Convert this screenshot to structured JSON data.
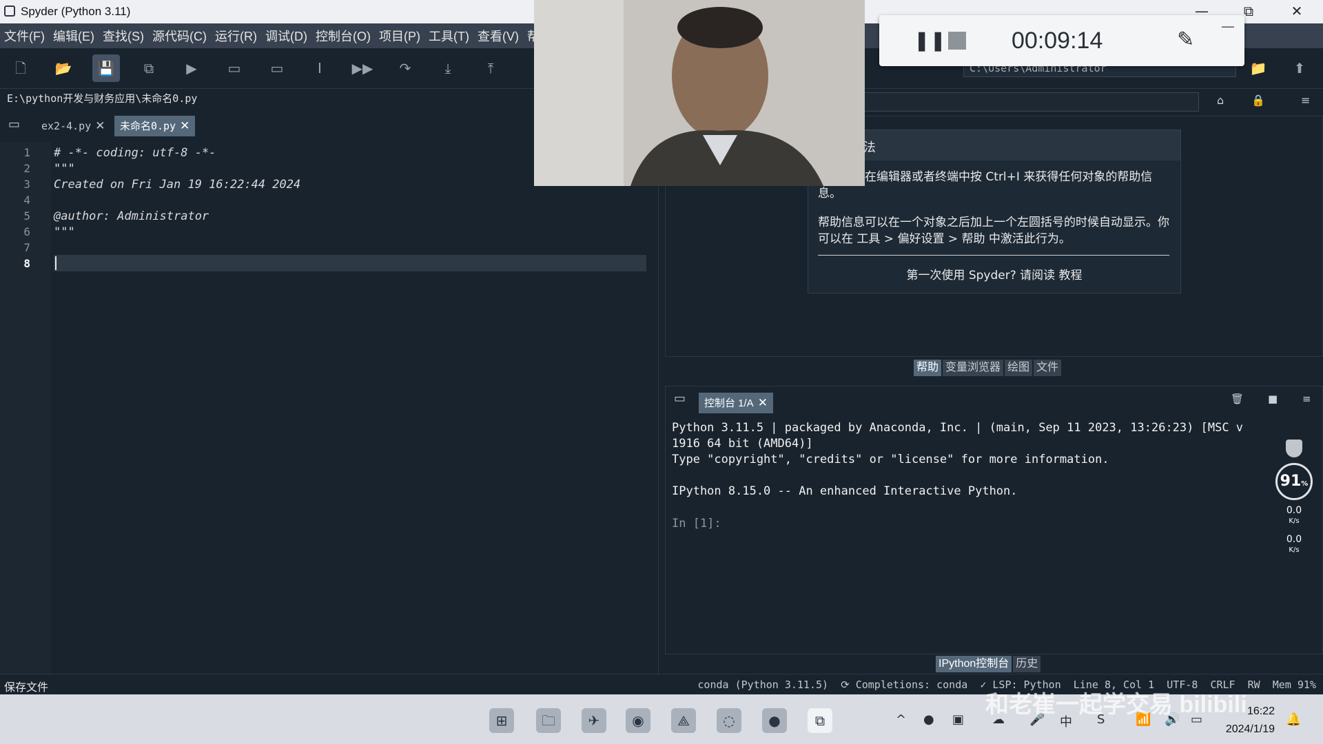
{
  "window": {
    "title": "Spyder (Python 3.11)",
    "minimize": "—",
    "maximize": "⧉",
    "close": "✕"
  },
  "menu": [
    "文件(F)",
    "编辑(E)",
    "查找(S)",
    "源代码(C)",
    "运行(R)",
    "调试(D)",
    "控制台(O)",
    "项目(P)",
    "工具(T)",
    "查看(V)",
    "帮助(H"
  ],
  "toolbar": {
    "icons": [
      "new-file-icon",
      "open-file-icon",
      "save-icon",
      "save-all-icon",
      "run-icon",
      "run-cell-icon",
      "run-cell-advance-icon",
      "run-selection-icon",
      "debug-icon",
      "step-icon",
      "step-into-icon",
      "step-return-icon"
    ],
    "cwd": "C:\\Users\\Administrator"
  },
  "editor": {
    "path": "E:\\python开发与财务应用\\未命名0.py",
    "tabs": [
      {
        "label": "ex2-4.py",
        "active": false
      },
      {
        "label": "未命名0.py",
        "active": true
      }
    ],
    "lines": [
      "# -*- coding: utf-8 -*-",
      "\"\"\"",
      "Created on Fri Jan 19 16:22:44 2024",
      "",
      "@author: Administrator",
      "\"\"\"",
      "",
      ""
    ],
    "line_numbers": [
      "1",
      "2",
      "3",
      "4",
      "5",
      "6",
      "7",
      "8"
    ],
    "current_line": 8
  },
  "help": {
    "title_fragment": "法",
    "para1": "可以通过在编辑器或者终端中按 Ctrl+I 来获得任何对象的帮助信息。",
    "para2": "帮助信息可以在一个对象之后加上一个左圆括号的时候自动显示。你可以在 工具 > 偏好设置 > 帮助 中激活此行为。",
    "tutorial": "第一次使用 Spyder? 请阅读 教程",
    "tabs": [
      "帮助",
      "变量浏览器",
      "绘图",
      "文件"
    ]
  },
  "console": {
    "tab": "控制台 1/A",
    "lines": [
      "Python 3.11.5 | packaged by Anaconda, Inc. | (main, Sep 11 2023, 13:26:23) [MSC v",
      "1916 64 bit (AMD64)]",
      "Type \"copyright\", \"credits\" or \"license\" for more information.",
      "",
      "IPython 8.15.0 -- An enhanced Interactive Python."
    ],
    "prompt": "In [1]:",
    "tabs": [
      "IPython控制台",
      "历史"
    ]
  },
  "status": {
    "left": "保存文件",
    "right": "conda (Python 3.11.5)  ⟳ Completions: conda  ✓ LSP: Python  Line 8, Col 1  UTF-8  CRLF  RW  Mem 91%"
  },
  "recorder": {
    "timer": "00:09:14"
  },
  "monitor": {
    "cpu": "91",
    "cpu_unit": "%",
    "up": "0.0",
    "down": "0.0",
    "rate_unit": "K/s"
  },
  "taskbar": {
    "time": "16:22",
    "date": "2024/1/19",
    "ime": "中"
  },
  "watermark": "和老崔一起学交易 bilibili"
}
